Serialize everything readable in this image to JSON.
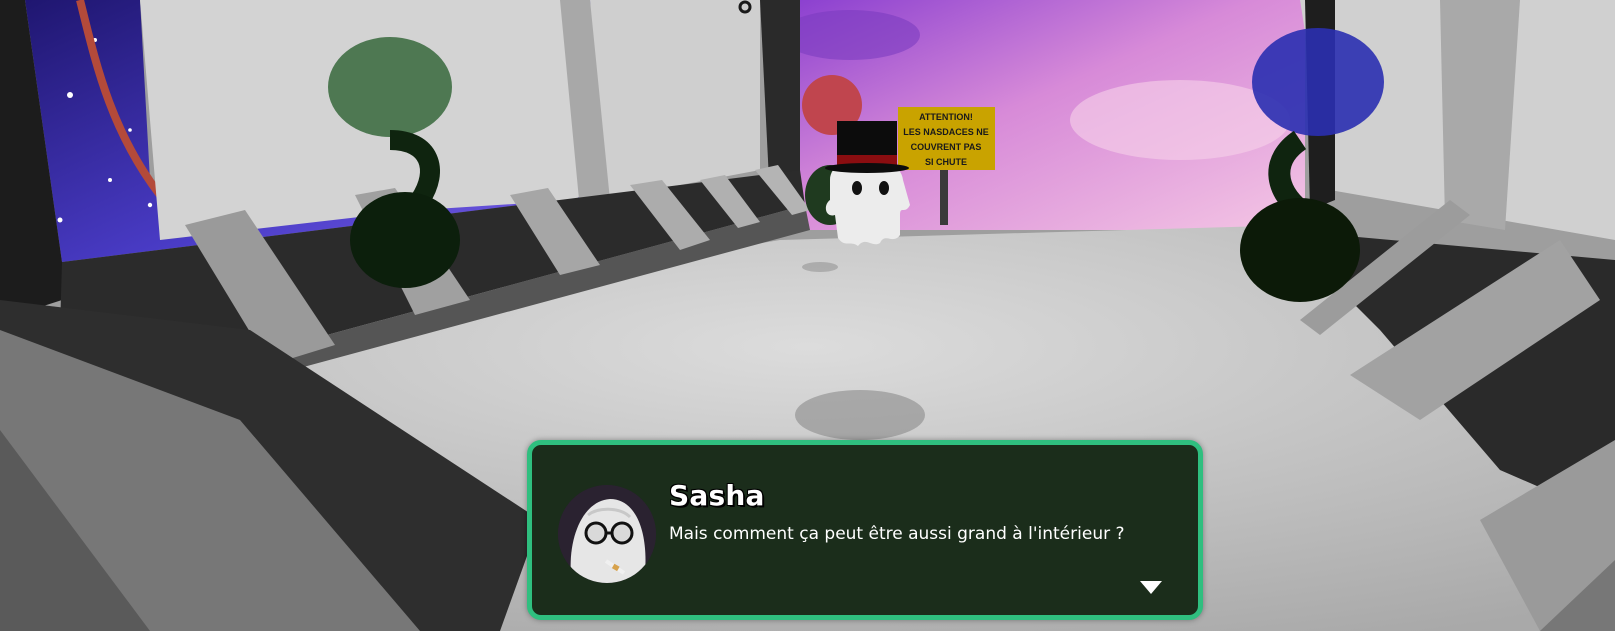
{
  "sign": {
    "lines": [
      "ATTENTION!",
      "LES NASDACES NE",
      "COUVRENT PAS",
      "SI CHUTE"
    ]
  },
  "dialog": {
    "speaker": "Sasha",
    "text": "Mais comment ça peut être aussi grand à l'intérieur ?",
    "avatar_icon": "ghost-with-glasses-portrait",
    "advance_icon": "triangle-down-icon"
  },
  "colors": {
    "dialog_bg": "#1b2d1b",
    "dialog_border": "#2fbf7f",
    "sign_yellow": "#c9a300",
    "balloon_green": "#3f6e44",
    "balloon_blue": "#2a2fb0",
    "balloon_red": "#c0454e"
  }
}
